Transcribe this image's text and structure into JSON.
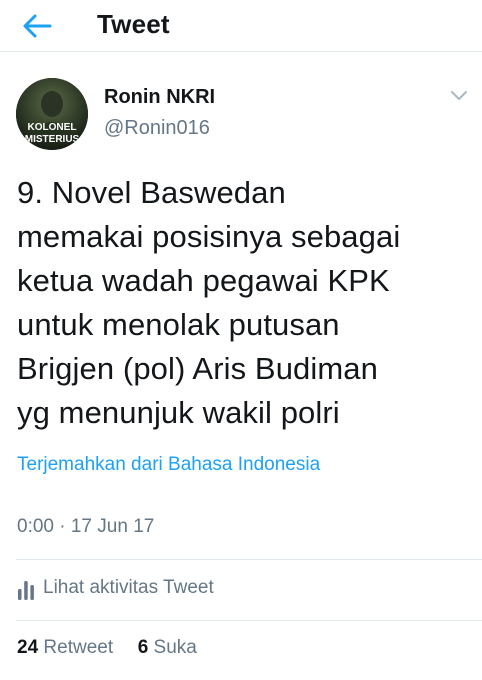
{
  "header": {
    "title": "Tweet",
    "back_icon": "arrow-left-icon",
    "accent": "#1da1f2"
  },
  "author": {
    "display_name": "Ronin NKRI",
    "handle": "@Ronin016",
    "avatar_text": [
      "KOLONEL",
      "MISTERIUS"
    ]
  },
  "tweet": {
    "lines": [
      "9. Novel Baswedan",
      "memakai posisinya sebagai",
      "ketua wadah pegawai KPK",
      "untuk menolak putusan",
      "Brigjen (pol) Aris Budiman",
      "yg menunjuk wakil polri"
    ],
    "translate_link": "Terjemahkan dari Bahasa Indonesia",
    "timestamp": "0:00 · 17 Jun 17"
  },
  "activity": {
    "label": "Lihat aktivitas Tweet",
    "icon": "bar-chart-icon"
  },
  "stats": {
    "retweets": {
      "count": "24",
      "label": "Retweet"
    },
    "likes": {
      "count": "6",
      "label": "Suka"
    }
  }
}
